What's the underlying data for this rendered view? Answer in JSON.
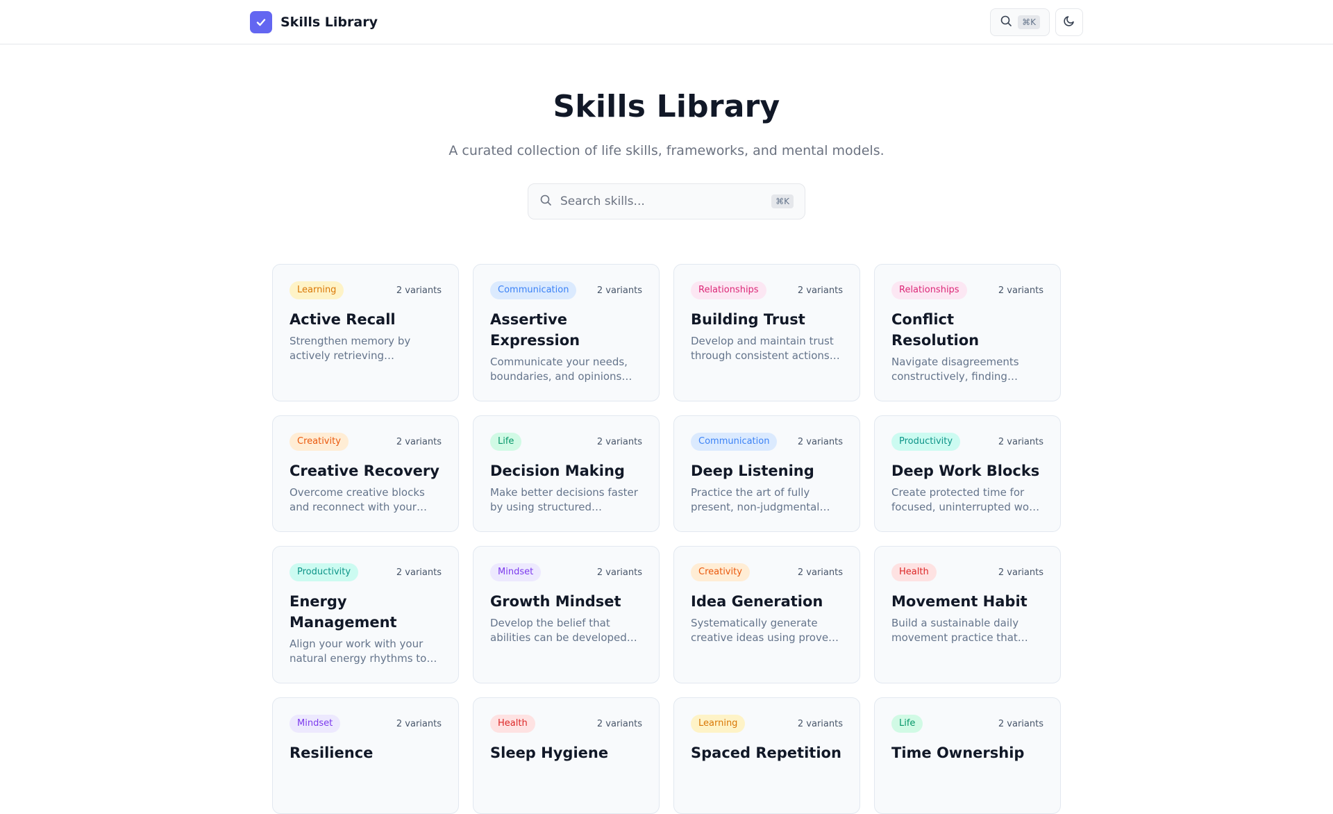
{
  "app": {
    "name": "Skills Library",
    "accent": "#6366f1"
  },
  "nav": {
    "search_shortcut": "⌘K"
  },
  "hero": {
    "title": "Skills Library",
    "subtitle": "A curated collection of life skills, frameworks, and mental models."
  },
  "search": {
    "placeholder": "Search skills...",
    "shortcut": "⌘K",
    "value": ""
  },
  "category_colors": {
    "Learning": {
      "bg": "#fef3c7",
      "fg": "#d97706"
    },
    "Communication": {
      "bg": "#dbeafe",
      "fg": "#3b82f6"
    },
    "Relationships": {
      "bg": "#fce7f3",
      "fg": "#db2777"
    },
    "Creativity": {
      "bg": "#ffedd5",
      "fg": "#ea580c"
    },
    "Life": {
      "bg": "#d1fae5",
      "fg": "#059669"
    },
    "Productivity": {
      "bg": "#ccfbf1",
      "fg": "#0d9488"
    },
    "Mindset": {
      "bg": "#ede9fe",
      "fg": "#7c3aed"
    },
    "Health": {
      "bg": "#fee2e2",
      "fg": "#dc2626"
    }
  },
  "skills": [
    {
      "category": "Learning",
      "variants": "2 variants",
      "title": "Active Recall",
      "description": "Strengthen memory by actively retrieving information from memory."
    },
    {
      "category": "Communication",
      "variants": "2 variants",
      "title": "Assertive Expression",
      "description": "Communicate your needs, boundaries, and opinions clearly and respectfully."
    },
    {
      "category": "Relationships",
      "variants": "2 variants",
      "title": "Building Trust",
      "description": "Develop and maintain trust through consistent actions, honesty and reliability."
    },
    {
      "category": "Relationships",
      "variants": "2 variants",
      "title": "Conflict Resolution",
      "description": "Navigate disagreements constructively, finding solutions that work for everyone."
    },
    {
      "category": "Creativity",
      "variants": "2 variants",
      "title": "Creative Recovery",
      "description": "Overcome creative blocks and reconnect with your creative energy."
    },
    {
      "category": "Life",
      "variants": "2 variants",
      "title": "Decision Making",
      "description": "Make better decisions faster by using structured frameworks."
    },
    {
      "category": "Communication",
      "variants": "2 variants",
      "title": "Deep Listening",
      "description": "Practice the art of fully present, non-judgmental listening."
    },
    {
      "category": "Productivity",
      "variants": "2 variants",
      "title": "Deep Work Blocks",
      "description": "Create protected time for focused, uninterrupted work sessions."
    },
    {
      "category": "Productivity",
      "variants": "2 variants",
      "title": "Energy Management",
      "description": "Align your work with your natural energy rhythms to maximize output."
    },
    {
      "category": "Mindset",
      "variants": "2 variants",
      "title": "Growth Mindset",
      "description": "Develop the belief that abilities can be developed through effort."
    },
    {
      "category": "Creativity",
      "variants": "2 variants",
      "title": "Idea Generation",
      "description": "Systematically generate creative ideas using proven techniques."
    },
    {
      "category": "Health",
      "variants": "2 variants",
      "title": "Movement Habit",
      "description": "Build a sustainable daily movement practice that sticks."
    },
    {
      "category": "Mindset",
      "variants": "2 variants",
      "title": "Resilience",
      "description": ""
    },
    {
      "category": "Health",
      "variants": "2 variants",
      "title": "Sleep Hygiene",
      "description": ""
    },
    {
      "category": "Learning",
      "variants": "2 variants",
      "title": "Spaced Repetition",
      "description": ""
    },
    {
      "category": "Life",
      "variants": "2 variants",
      "title": "Time Ownership",
      "description": ""
    }
  ]
}
